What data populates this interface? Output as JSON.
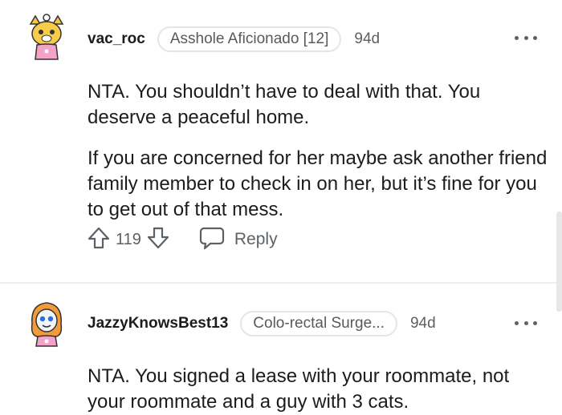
{
  "comments": [
    {
      "username": "vac_roc",
      "flair": "Asshole Aficionado [12]",
      "age": "94d",
      "paragraphs": [
        "NTA. You shouldn’t have to deal with that. You deserve a peaceful home.",
        "If you are concerned for her maybe ask another friend family member to check in on her, but it’s fine for you to get out of that mess."
      ],
      "score": "119",
      "reply_label": "Reply"
    },
    {
      "username": "JazzyKnowsBest13",
      "flair": "Colo-rectal Surge...",
      "age": "94d",
      "paragraphs": [
        "NTA. You signed a lease with your roommate, not your roommate and a guy with 3 cats."
      ]
    }
  ],
  "icons": {
    "upvote": "arrow-up-icon",
    "downvote": "arrow-down-icon",
    "reply": "speech-bubble-icon",
    "more": "more-horizontal-icon"
  },
  "colors": {
    "text": "#1c1c1c",
    "muted": "#5c6166",
    "flair_border": "#e3e6e8",
    "divider": "#edeff1"
  }
}
